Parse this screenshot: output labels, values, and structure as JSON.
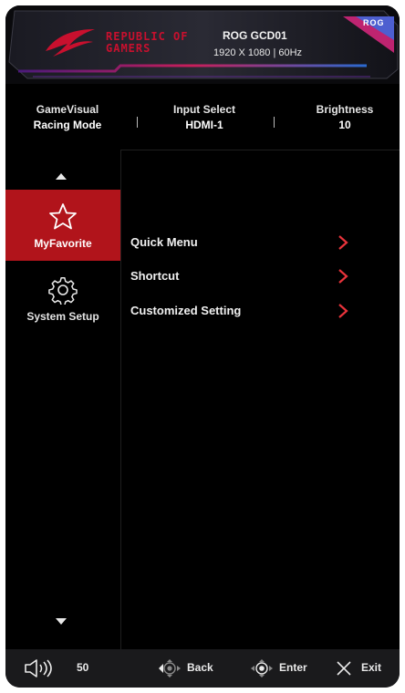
{
  "header": {
    "brand_line1": "REPUBLIC OF",
    "brand_line2": "GAMERS",
    "badge": "ROG",
    "model": "ROG GCD01",
    "resolution": "1920 X 1080 | 60Hz"
  },
  "status": [
    {
      "label": "GameVisual",
      "value": "Racing Mode"
    },
    {
      "label": "Input Select",
      "value": "HDMI-1"
    },
    {
      "label": "Brightness",
      "value": "10"
    }
  ],
  "sidebar": {
    "items": [
      {
        "label": "MyFavorite",
        "icon": "star-icon",
        "selected": true
      },
      {
        "label": "System Setup",
        "icon": "gear-icon",
        "selected": false
      }
    ]
  },
  "menu": [
    {
      "label": "Quick Menu"
    },
    {
      "label": "Shortcut"
    },
    {
      "label": "Customized Setting"
    }
  ],
  "footer": {
    "volume": "50",
    "back": "Back",
    "enter": "Enter",
    "exit": "Exit"
  },
  "colors": {
    "accent": "#b1141b",
    "chevron": "#e8333b",
    "background": "#000000"
  }
}
